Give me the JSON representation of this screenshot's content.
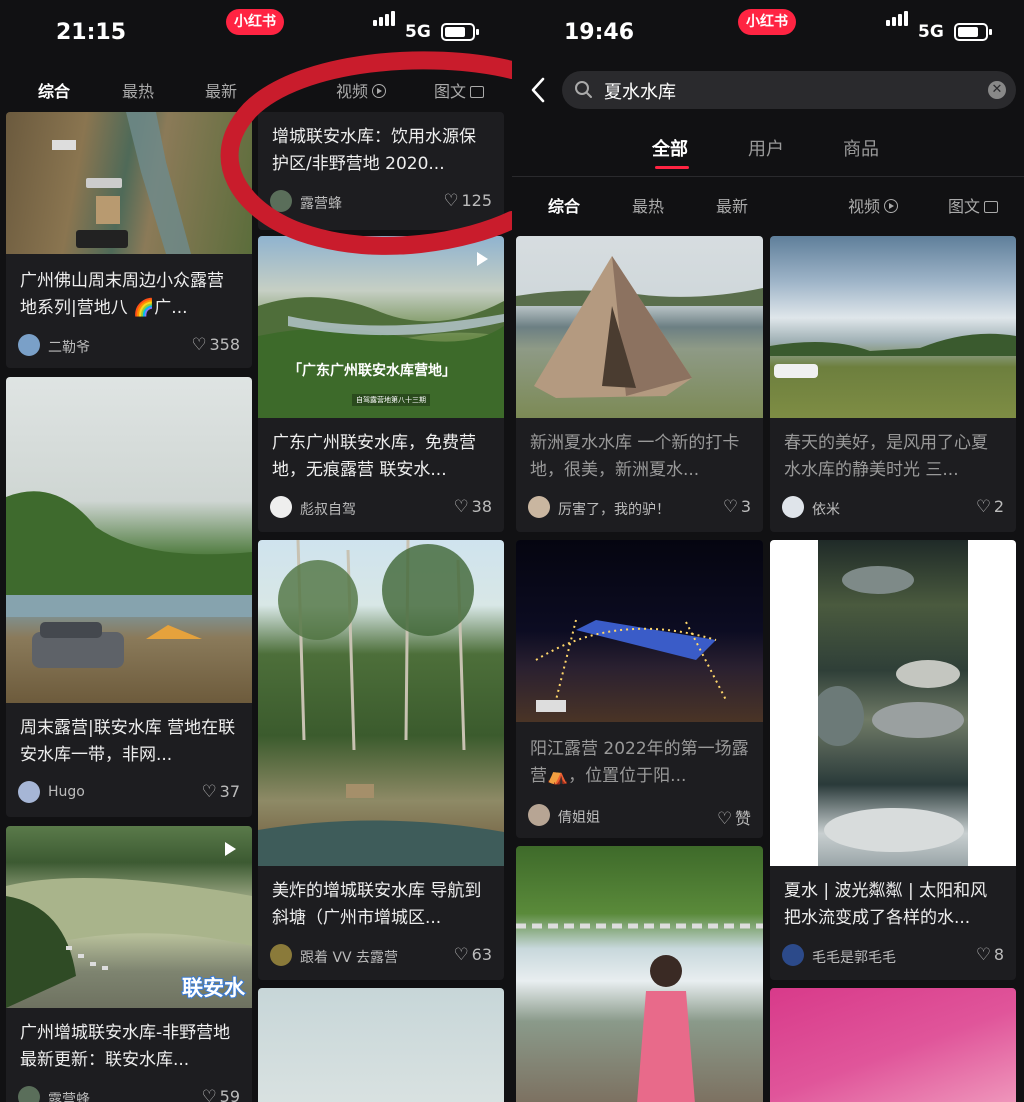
{
  "left": {
    "status": {
      "time": "21:15",
      "app": "小红书",
      "net": "5G"
    },
    "tabs": [
      {
        "label": "综合"
      },
      {
        "label": "最热"
      },
      {
        "label": "最新"
      },
      {
        "label": "视频"
      },
      {
        "label": "图文"
      }
    ],
    "cards": [
      {
        "title": "广州佛山周末周边小众露营地系列|营地八 🌈广...",
        "author": "二勒爷",
        "likes": "358"
      },
      {
        "title": "增城联安水库：饮用水源保护区/非野营地 2020...",
        "author": "露营蜂",
        "likes": "125"
      },
      {
        "title": "广东广州联安水库，免费营地，无痕露营 联安水...",
        "author": "彪叔自驾",
        "likes": "38",
        "overlay": "「广东广州联安水库营地」",
        "sub_overlay": "自驾露营地第八十三期"
      },
      {
        "title": "周末露营|联安水库 营地在联安水库一带，非网...",
        "author": "Hugo",
        "likes": "37"
      },
      {
        "title": "美炸的增城联安水库 导航到斜塘（广州市增城区...",
        "author": "跟着 VV 去露营",
        "likes": "63"
      },
      {
        "title": "广州增城联安水库-非野营地 最新更新：联安水库...",
        "author": "露营蜂",
        "likes": "59",
        "overlay": "联安水"
      }
    ]
  },
  "right": {
    "status": {
      "time": "19:46",
      "app": "小红书",
      "net": "5G"
    },
    "search": {
      "query": "夏水水库"
    },
    "scope_tabs": [
      {
        "label": "全部"
      },
      {
        "label": "用户"
      },
      {
        "label": "商品"
      }
    ],
    "tabs": [
      {
        "label": "综合"
      },
      {
        "label": "最热"
      },
      {
        "label": "最新"
      },
      {
        "label": "视频"
      },
      {
        "label": "图文"
      }
    ],
    "cards": [
      {
        "title": "新洲夏水水库 一个新的打卡地，很美，新洲夏水...",
        "author": "厉害了，我的驴！",
        "likes": "3"
      },
      {
        "title": "春天的美好，是风用了心夏水水库的静美时光 三...",
        "author": "依米",
        "likes": "2"
      },
      {
        "title": "阳江露营 2022年的第一场露营⛺，位置位于阳...",
        "author": "倩姐姐",
        "likes": "赞"
      },
      {
        "title": "夏水 | 波光粼粼 | 太阳和风把水流变成了各样的水...",
        "author": "毛毛是郭毛毛",
        "likes": "8"
      }
    ]
  }
}
